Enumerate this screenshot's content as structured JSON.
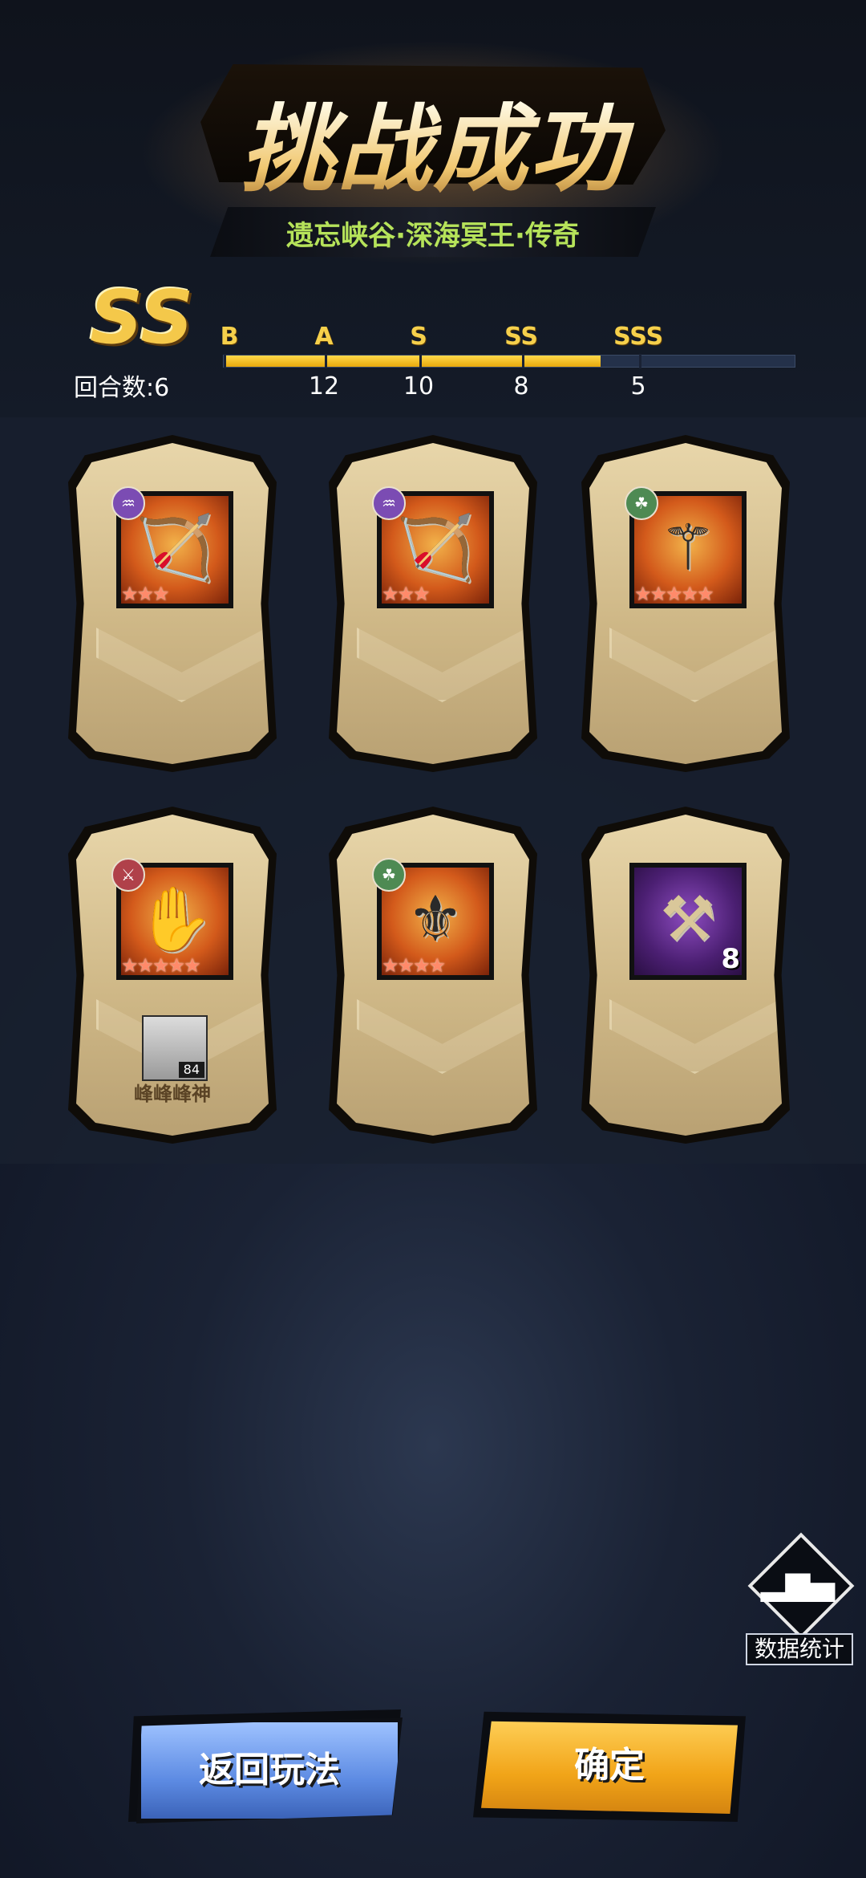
{
  "header": {
    "title": "挑战成功",
    "subtitle": "遗忘峡谷·深海冥王·传奇"
  },
  "result": {
    "rank": "SS",
    "round_label": "回合数:6",
    "progress_fraction": 0.66
  },
  "grades": [
    {
      "label": "B",
      "value": ""
    },
    {
      "label": "A",
      "value": "12"
    },
    {
      "label": "S",
      "value": "10"
    },
    {
      "label": "SS",
      "value": "8"
    },
    {
      "label": "SSS",
      "value": "5"
    }
  ],
  "rewards": [
    {
      "type_icon": "magic-rune-icon",
      "item_icon": "bow-icon",
      "stars": "★★★",
      "quantity": "",
      "owner": null
    },
    {
      "type_icon": "magic-rune-icon",
      "item_icon": "bow-icon",
      "stars": "★★★",
      "quantity": "",
      "owner": null
    },
    {
      "type_icon": "nature-rune-icon",
      "item_icon": "scepter-icon",
      "stars": "★★★★★",
      "quantity": "",
      "owner": null
    },
    {
      "type_icon": "blade-rune-icon",
      "item_icon": "gauntlet-icon",
      "stars": "★★★★★",
      "quantity": "",
      "owner": {
        "name": "峰峰峰神",
        "level": "84"
      }
    },
    {
      "type_icon": "nature-rune-icon",
      "item_icon": "staff-icon",
      "stars": "★★★★",
      "quantity": "",
      "owner": null
    },
    {
      "type_icon": "",
      "item_icon": "forge-hammer-icon",
      "stars": "",
      "quantity": "8",
      "owner": null
    }
  ],
  "stats_button": {
    "label": "数据统计",
    "icon": "bar-chart-icon"
  },
  "buttons": {
    "back": "返回玩法",
    "confirm": "确定"
  },
  "colors": {
    "gold": "#f6d04b",
    "subtitle_green": "#b6e35a",
    "back_blue": "#5d8be3",
    "confirm_orange": "#f1a418"
  }
}
